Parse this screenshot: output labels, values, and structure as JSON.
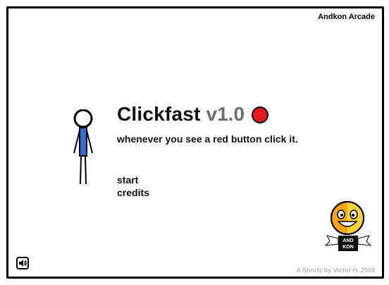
{
  "header": {
    "arcade_label": "Andkon Arcade"
  },
  "title": {
    "name": "Clickfast",
    "version": "v1.0",
    "button_color": "#e51a1a"
  },
  "subtitle": "whenever you see a red button click it.",
  "menu": {
    "start": "start",
    "credits": "credits"
  },
  "mascot": {
    "badge_line1": "AND",
    "badge_line2": "KON"
  },
  "footer": {
    "byline": "A Shortz by Victor H. 2008"
  },
  "controls": {
    "sound_icon": "speaker-icon"
  },
  "colors": {
    "figure_shirt": "#2d6fd3",
    "mascot_face": "#f9a51a",
    "border": "#000000"
  }
}
